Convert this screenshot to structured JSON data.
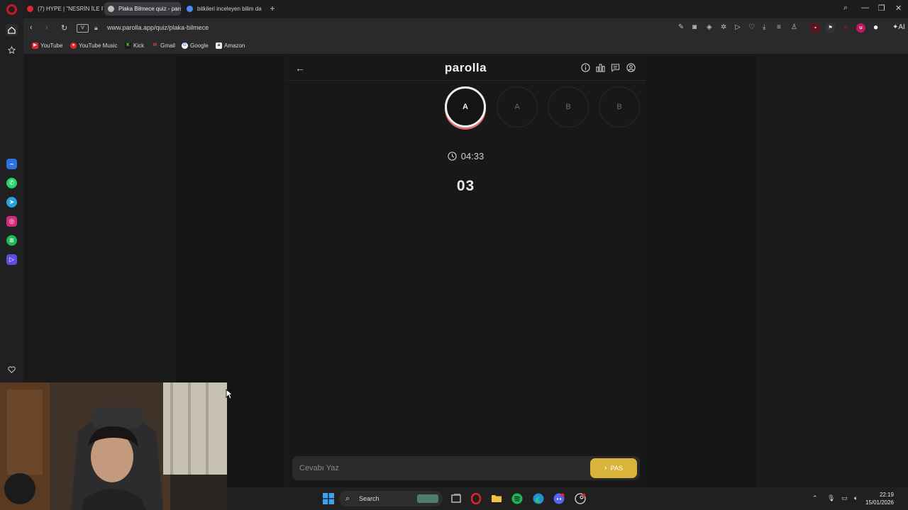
{
  "browser": {
    "tabs": [
      {
        "label": "(7) HYPE | \"NESRİN İLE PA",
        "favicon_color": "#e0262d",
        "active": false
      },
      {
        "label": "Plaka Bilmece quiz - parol",
        "favicon_color": "#bdbdbd",
        "active": true
      },
      {
        "label": "bitkileri inceleyen bilim da",
        "favicon_color": "#4a8bf5",
        "active": false
      }
    ],
    "url": "www.parolla.app/quiz/plaka-bilmece",
    "vpn_label": "V",
    "bookmarks": [
      {
        "label": "YouTube",
        "icon_letter": "▶",
        "color": "#e0262d"
      },
      {
        "label": "YouTube Music",
        "icon_letter": "●",
        "color": "#e0262d"
      },
      {
        "label": "Kick",
        "icon_letter": "K",
        "color": "#53fc18"
      },
      {
        "label": "Gmail",
        "icon_letter": "M",
        "color": "#ea4335"
      },
      {
        "label": "Google",
        "icon_letter": "G",
        "color": "#4285f4"
      },
      {
        "label": "Amazon",
        "icon_letter": "a",
        "color": "#ff9900"
      }
    ]
  },
  "app": {
    "brand": "parolla",
    "letters": [
      {
        "letter": "A",
        "state": "active"
      },
      {
        "letter": "A",
        "state": "pending"
      },
      {
        "letter": "B",
        "state": "pending"
      },
      {
        "letter": "B",
        "state": "pending"
      }
    ],
    "timer": "04:33",
    "plate_number": "03",
    "answer_placeholder": "Cevabı Yaz",
    "pass_label": "PAS"
  },
  "taskbar": {
    "search_label": "Search",
    "time": "22:19",
    "date": "15/01/2026"
  },
  "colors": {
    "accent_pass": "#d9b33a",
    "active_ring_shadow": "#d96a6a",
    "opera_red": "#c2182b"
  }
}
